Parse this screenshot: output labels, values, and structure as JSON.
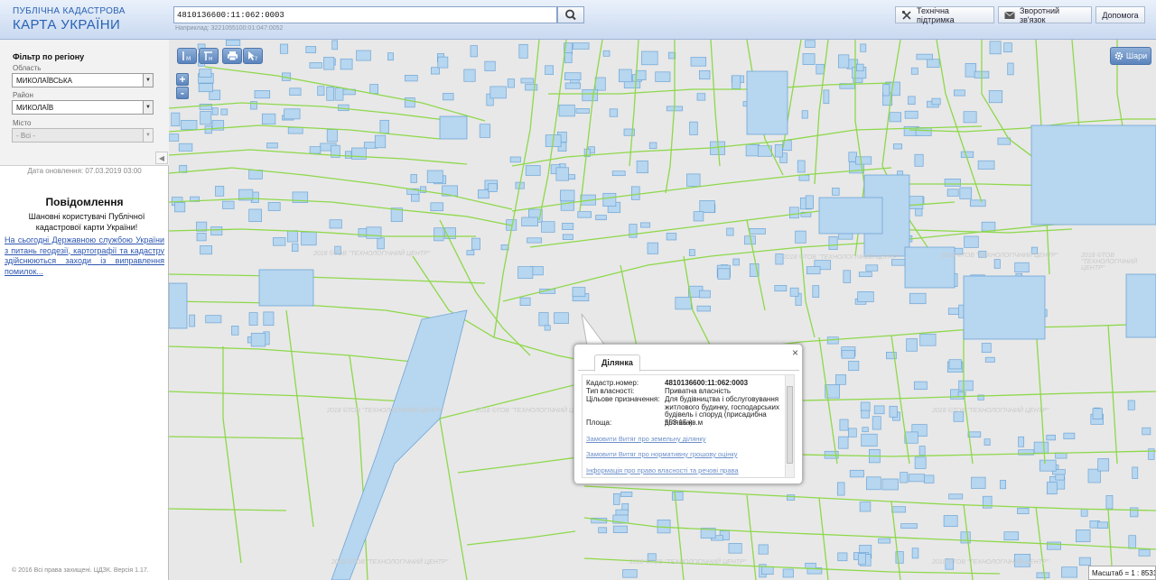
{
  "header": {
    "logo_line1": "ПУБЛІЧНА КАДАСТРОВА",
    "logo_line2": "КАРТА УКРАЇНИ",
    "search_value": "4810136600:11:062:0003",
    "search_hint": "Наприклад: 3221055100:01:047:0052",
    "buttons": {
      "support": "Технічна підтримка",
      "feedback": "Зворотний зв'язок",
      "help": "Допомога"
    }
  },
  "sidebar": {
    "filter_title": "Фільтр по регіону",
    "region_label": "Область",
    "region_value": "МИКОЛАЇВСЬКА",
    "district_label": "Район",
    "district_value": "МИКОЛАЇВ",
    "city_label": "Місто",
    "city_value": "- Всі -",
    "update_date": "Дата оновлення: 07.03.2019 03:00",
    "notice_title": "Повідомлення",
    "notice_text": "Шановні користувачі Публічної кадастрової карти України!",
    "notice_link": "На сьогодні Державною службою України з питань геодезії, картографії та кадастру здійснюються заходи із виправлення помилок...",
    "copyright": "© 2016 Всі права захищені. ЦДЗК. Версія 1.17."
  },
  "map": {
    "layers_label": "Шари",
    "zoom_in": "+",
    "zoom_out": "-",
    "scale_label": "Масштаб = 1 : 8531",
    "watermark": "2018 ©ТОВ \"ТЕХНОЛОГІЧНИЙ ЦЕНТР\"",
    "colors": {
      "background": "#e8e8e8",
      "parcel_line": "#8ed84a",
      "building_fill": "#b7d6ef",
      "building_stroke": "#6fa6d6"
    }
  },
  "popup": {
    "tab_label": "Ділянка",
    "rows": [
      {
        "key": "Кадастр.номер:",
        "value": "4810136600:11:062:0003"
      },
      {
        "key": "Тип власності:",
        "value": "Приватна власність"
      },
      {
        "key": "Цільове призначення:",
        "value": "Для будівництва і обслуговування житлового будинку, господарських будівель і споруд (присадибна ділянка)"
      },
      {
        "key": "Площа:",
        "value": "553.15 кв.м"
      }
    ],
    "links": [
      "Замовити Витяг про земельну ділянку",
      "Замовити Витяг про нормативну грошову оцінку",
      "Інформація про право власності та речові права"
    ],
    "close_icon": "close-icon"
  }
}
